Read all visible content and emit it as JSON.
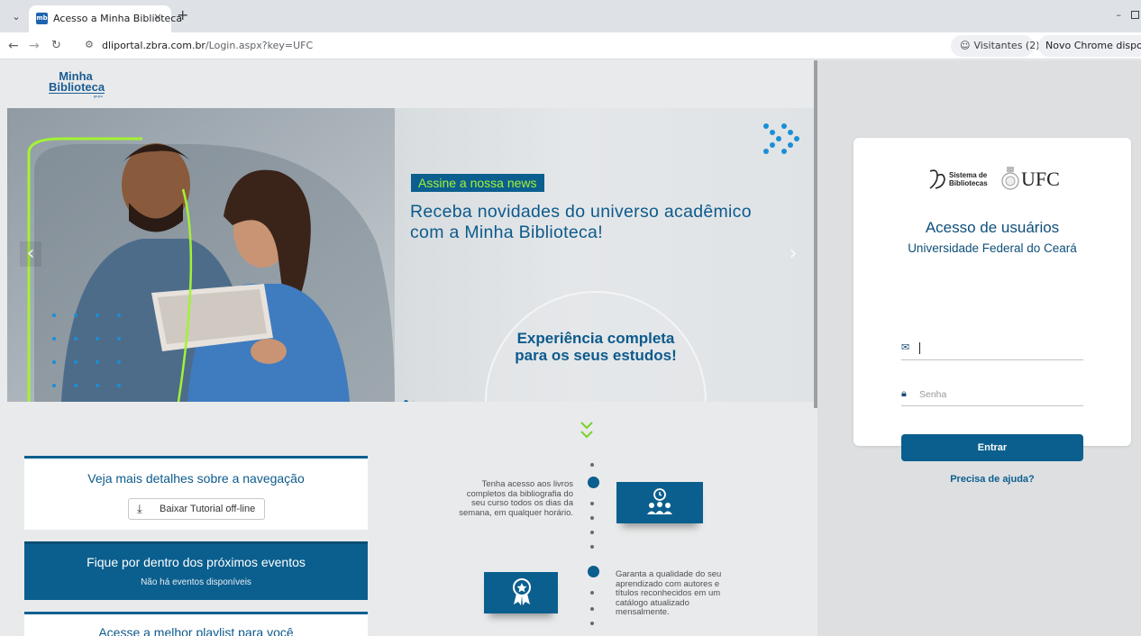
{
  "browser": {
    "tab_title": "Acesso a Minha Biblioteca",
    "tab_close": "×",
    "new_tab": "+",
    "url_host": "dliportal.zbra.com.br",
    "url_path": "/Login.aspx?key=UFC",
    "visitors_label": "Visitantes (2)",
    "update_label": "Novo Chrome disponível"
  },
  "header": {
    "logo_line1": "Minha",
    "logo_line2": "Biblioteca",
    "logo_small": "grupo"
  },
  "banner": {
    "badge": "Assine a nossa news",
    "headline": "Receba novidades do universo acadêmico com a Minha Biblioteca!",
    "experience_text": "Experiência completa para os seus estudos!",
    "slides_total": 2,
    "active_slide": 1
  },
  "cards": {
    "navigation_title": "Veja mais detalhes sobre a navegação",
    "tutorial_button": "Baixar Tutorial off-line",
    "events_title": "Fique por dentro dos próximos eventos",
    "events_empty": "Não há eventos disponíveis",
    "playlist_title": "Acesse a melhor playlist para você"
  },
  "features": {
    "feature1": "Tenha acesso aos livros completos da bibliografia do seu curso todos os dias da semana, em qualquer horário.",
    "feature2": "Garanta a qualidade do seu aprendizado com autores e títulos reconhecidos em um catálogo atualizado mensalmente."
  },
  "login": {
    "logo_text_sb": "Sistema de Bibliotecas",
    "logo_text_ufc": "UFC",
    "title": "Acesso de usuários",
    "subtitle": "Universidade Federal do Ceará",
    "email_value": "",
    "password_placeholder": "Senha",
    "submit_label": "Entrar",
    "help_link": "Precisa de ajuda?"
  },
  "colors": {
    "brand_blue": "#0b5f8e",
    "accent_green": "#a3f235"
  }
}
